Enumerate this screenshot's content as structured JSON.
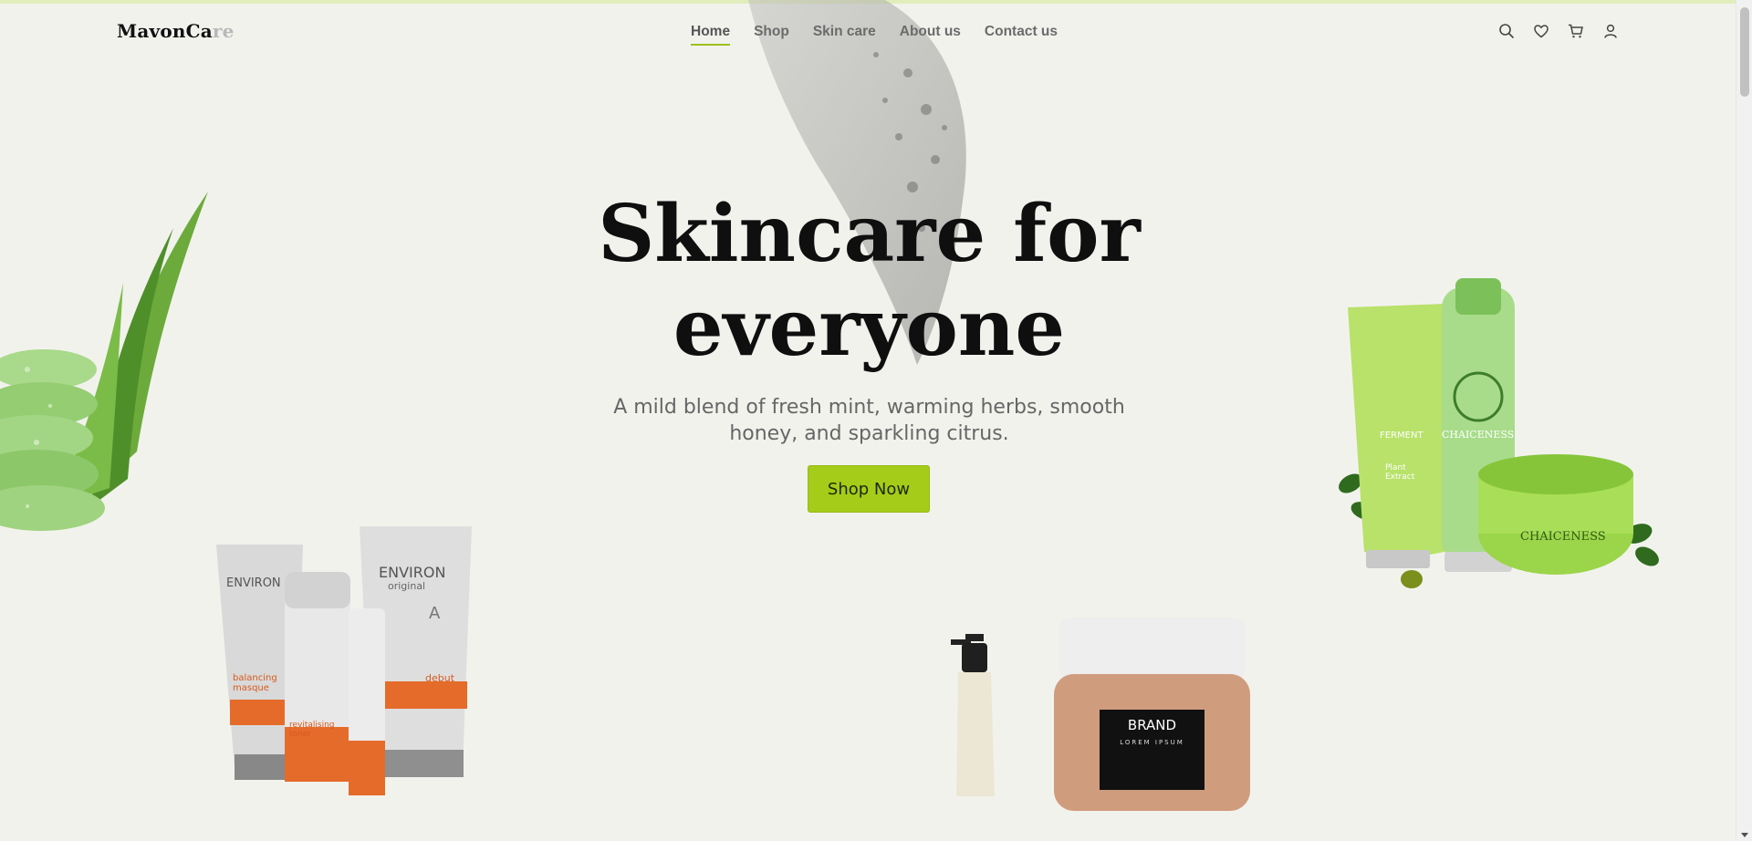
{
  "brand": {
    "logo_main": "MavonCa",
    "logo_faded": "re"
  },
  "nav": {
    "items": [
      {
        "label": "Home",
        "active": true
      },
      {
        "label": "Shop"
      },
      {
        "label": "Skin care"
      },
      {
        "label": "About us"
      },
      {
        "label": "Contact us"
      }
    ]
  },
  "header_icons": [
    "search-icon",
    "heart-icon",
    "cart-icon",
    "user-icon"
  ],
  "hero": {
    "title_line1": "Skincare for",
    "title_line2": "everyone",
    "subtitle_line1": "A mild blend of fresh mint, warming herbs, smooth",
    "subtitle_line2": "honey, and sparkling citrus.",
    "cta_label": "Shop Now"
  },
  "products": {
    "environ_brand": "ENVIRON",
    "environ_sub": "original",
    "environ_letter": "A",
    "environ_masque": "balancing masque",
    "environ_toner": "revitalising toner",
    "environ_debut": "debut",
    "chaiceness_brand": "CHAICENESS",
    "chaiceness_ferment": "FERMENT",
    "chaiceness_plant": "Plant Extract",
    "jar_brand": "BRAND",
    "jar_sub": "LOREM IPSUM"
  },
  "colors": {
    "accent": "#a6cc1a",
    "background": "#f2f2ed",
    "text": "#0f0f0f"
  }
}
